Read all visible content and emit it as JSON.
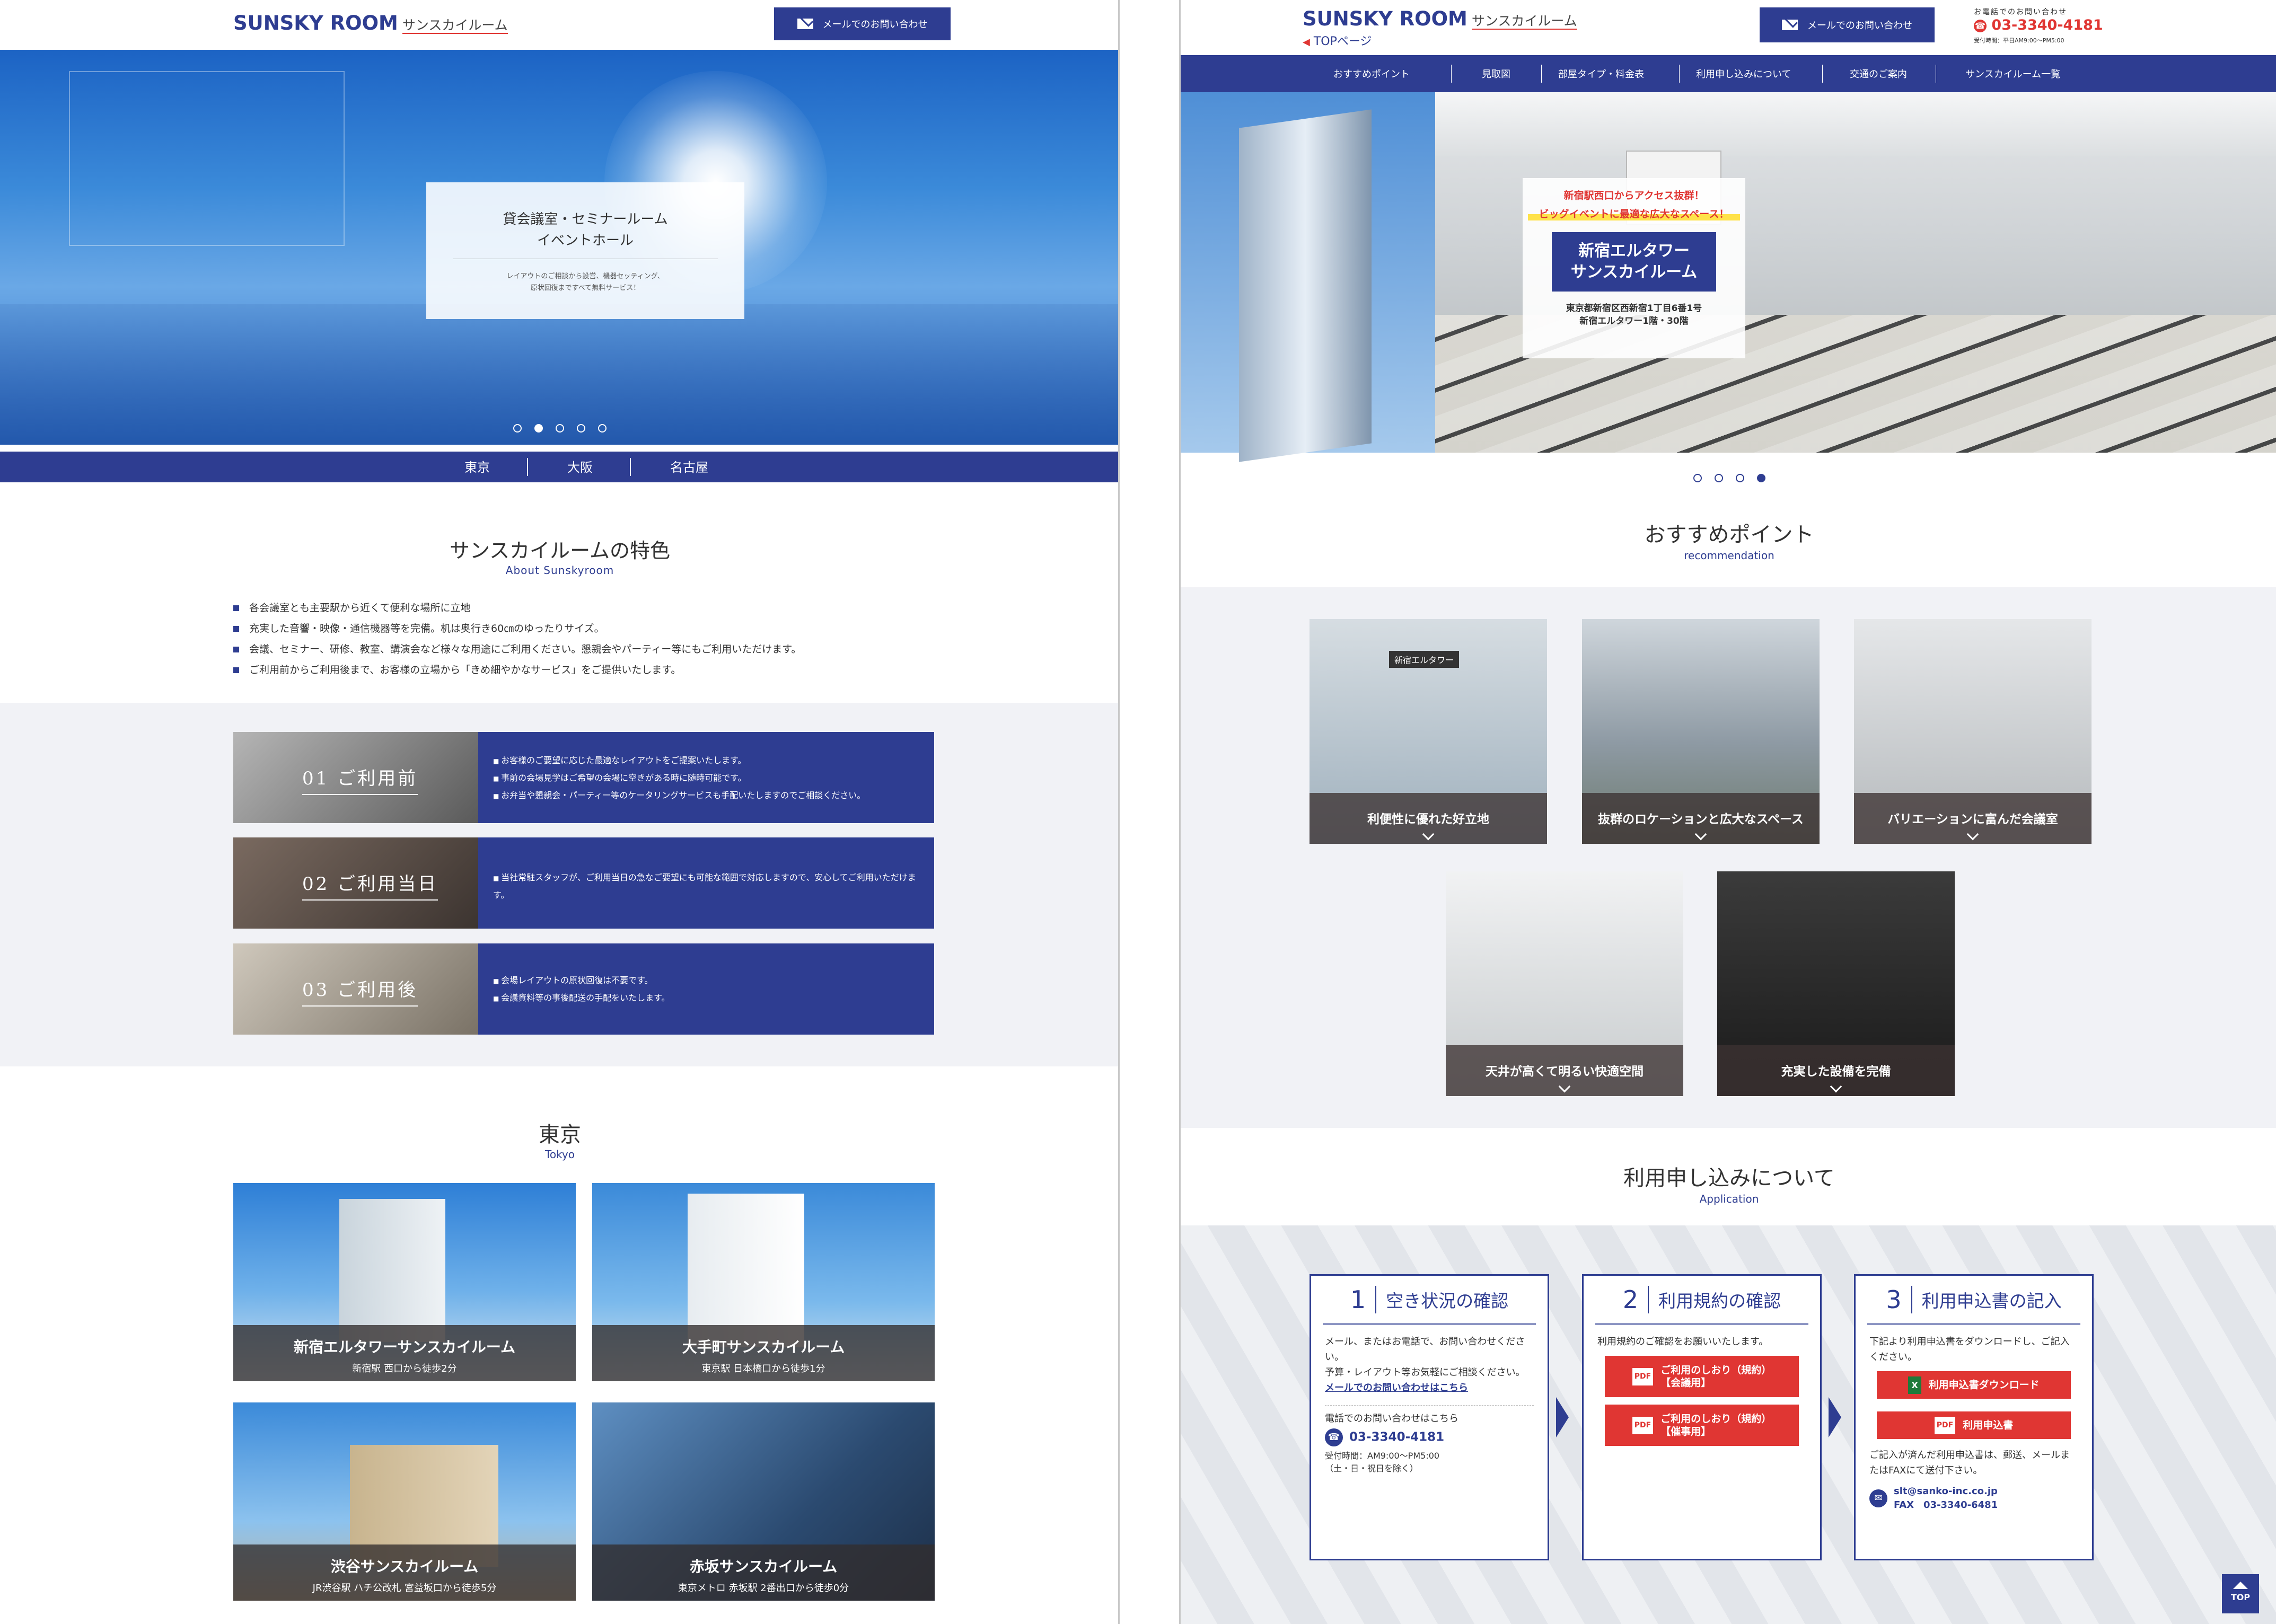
{
  "left": {
    "logo": {
      "main": "SUNSKY ROOM",
      "sub": "サンスカイルーム"
    },
    "mail_button": "メールでのお問い合わせ",
    "hero": {
      "title_line1": "貸会議室・セミナールーム",
      "title_line2": "イベントホール",
      "desc_line1": "レイアウトのご相談から設営、機器セッティング、",
      "desc_line2": "原状回復まですべて無料サービス！"
    },
    "area_tabs": [
      "東京",
      "大阪",
      "名古屋"
    ],
    "features": {
      "heading": "サンスカイルームの特色",
      "subheading": "About Sunskyroom",
      "items": [
        "各会議室とも主要駅から近くて便利な場所に立地",
        "充実した音響・映像・通信機器等を完備。机は奥行き60㎝のゆったりサイズ。",
        "会議、セミナー、研修、教室、講演会など様々な用途にご利用ください。懇親会やパーティー等にもご利用いただけます。",
        "ご利用前からご利用後まで、お客様の立場から「きめ細やかなサービス」をご提供いたします。"
      ]
    },
    "steps": [
      {
        "label": "01 ご利用前",
        "items": [
          "お客様のご要望に応じた最適なレイアウトをご提案いたします。",
          "事前の会場見学はご希望の会場に空きがある時に随時可能です。",
          "お弁当や懇親会・パーティー等のケータリングサービスも手配いたしますのでご相談ください。"
        ]
      },
      {
        "label": "02 ご利用当日",
        "items": [
          "当社常駐スタッフが、ご利用当日の急なご要望にも可能な範囲で対応しますので、安心してご利用いただけます。"
        ]
      },
      {
        "label": "03 ご利用後",
        "items": [
          "会場レイアウトの原状回復は不要です。",
          "会議資料等の事後配送の手配をいたします。"
        ]
      }
    ],
    "tokyo": {
      "heading": "東京",
      "subheading": "Tokyo",
      "rooms": [
        {
          "name": "新宿エルタワーサンスカイルーム",
          "access": "新宿駅 西口から徒歩2分"
        },
        {
          "name": "大手町サンスカイルーム",
          "access": "東京駅 日本橋口から徒歩1分"
        },
        {
          "name": "渋谷サンスカイルーム",
          "access": "JR渋谷駅 ハチ公改札 宮益坂口から徒歩5分"
        },
        {
          "name": "赤坂サンスカイルーム",
          "access": "東京メトロ 赤坂駅 2番出口から徒歩0分"
        }
      ]
    }
  },
  "right": {
    "logo": {
      "main": "SUNSKY ROOM",
      "sub": "サンスカイルーム"
    },
    "top_link": "TOPページ",
    "mail_button": "メールでのお問い合わせ",
    "phone": {
      "caption": "お電話でのお問い合わせ",
      "number": "03-3340-4181",
      "hours": "受付時間：平日AM9:00～PM5:00"
    },
    "nav": [
      "おすすめポイント",
      "見取図",
      "部屋タイプ・料金表",
      "利用申し込みについて",
      "交通のご案内",
      "サンスカイルーム一覧"
    ],
    "hero": {
      "catch1": "新宿駅西口からアクセス抜群！",
      "catch2": "ビッグイベントに最適な広大なスペース！",
      "name_line1": "新宿エルタワー",
      "name_line2": "サンスカイルーム",
      "addr_line1": "東京都新宿区西新宿1丁目6番1号",
      "addr_line2": "新宿エルタワー1階・30階"
    },
    "recommend": {
      "heading": "おすすめポイント",
      "subheading": "recommendation",
      "items": [
        "利便性に優れた好立地",
        "抜群のロケーションと広大なスペース",
        "バリエーションに富んだ会議室",
        "天井が高くて明るい快適空間",
        "充実した設備を完備"
      ],
      "photo_sign": "新宿エルタワー"
    },
    "application": {
      "heading": "利用申し込みについて",
      "subheading": "Application",
      "steps": [
        {
          "num": "1",
          "title": "空き状況の確認",
          "text1": "メール、またはお電話で、お問い合わせください。",
          "text2": "予算・レイアウト等お気軽にご相談ください。",
          "link": "メールでのお問い合わせはこちら",
          "phone_label": "電話でのお問い合わせはこちら",
          "phone": "03-3340-4181",
          "hours1": "受付時間：AM9:00～PM5:00",
          "hours2": "（土・日・祝日を除く）"
        },
        {
          "num": "2",
          "title": "利用規約の確認",
          "text1": "利用規約のご確認をお願いいたします。",
          "btn1_line1": "ご利用のしおり（規約）",
          "btn1_line2": "【会議用】",
          "btn2_line1": "ご利用のしおり（規約）",
          "btn2_line2": "【催事用】"
        },
        {
          "num": "3",
          "title": "利用申込書の記入",
          "text1": "下記より利用申込書をダウンロードし、ご記入ください。",
          "btn1": "利用申込書ダウンロード",
          "btn2": "利用申込書",
          "text2": "ご記入が済んだ利用申込書は、郵送、メールまたはFAXにて送付下さい。",
          "email": "slt@sanko-inc.co.jp",
          "fax": "FAX　03-3340-6481"
        }
      ]
    },
    "top_button": "TOP"
  },
  "colors": {
    "brand": "#2e3d91",
    "red": "#e03633",
    "light_bg": "#f1f2f6"
  }
}
